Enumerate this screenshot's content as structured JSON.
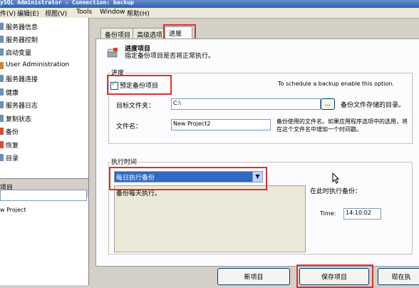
{
  "window": {
    "title": "ySQL Administrator - Connection: backup"
  },
  "menu": [
    {
      "label": "件(V)"
    },
    {
      "label": "编辑(E)"
    },
    {
      "label": "视图(V)"
    },
    {
      "label": "Tools"
    },
    {
      "label": "Window"
    },
    {
      "label": "帮助(H)"
    }
  ],
  "sidebar": {
    "items": [
      {
        "label": "服务器信息"
      },
      {
        "label": "服务器控制"
      },
      {
        "label": "启动变量"
      },
      {
        "label": "User Administration"
      },
      {
        "label": "服务器连接"
      },
      {
        "label": "健康"
      },
      {
        "label": "服务器日志"
      },
      {
        "label": "复制状态"
      },
      {
        "label": "备份"
      },
      {
        "label": "恢复"
      },
      {
        "label": "目录"
      }
    ],
    "projects_header": "项目",
    "project_search_value": "",
    "projects": [
      "w Project"
    ]
  },
  "tabs": [
    {
      "label": "备份项目"
    },
    {
      "label": "高级选项"
    },
    {
      "label": "进度"
    }
  ],
  "header": {
    "title": "进度项目",
    "subtitle": "指定备份项目是否将正常执行。"
  },
  "progress_group": {
    "label": "进度",
    "schedule_checkbox_label": "预定备份项目",
    "schedule_checked": true,
    "hint": "To schedule a backup enable this option.",
    "target_folder_label": "目标文件夹：",
    "target_folder_value": "C:\\",
    "browse_label": "...",
    "target_folder_hint": "备份文件存储的目录。",
    "filename_label": "文件名：",
    "filename_value": "New Project2",
    "filename_hint": "备份使用的文件名。如果应用程序选项中的选用，将在这个文件名中增加一个时间戳。"
  },
  "exec_group": {
    "label": "执行时间",
    "frequency_value": "每日执行备份",
    "frequency_desc": "备份每天执行。",
    "exec_at_label": "在此时执行备份：",
    "time_label": "Time:",
    "time_value": "14:10:02"
  },
  "buttons": {
    "new_project": "新项目",
    "save_project": "保存项目",
    "execute_now": "现在执"
  },
  "colors": {
    "highlight": "#e03030",
    "selection": "#316ac5"
  }
}
